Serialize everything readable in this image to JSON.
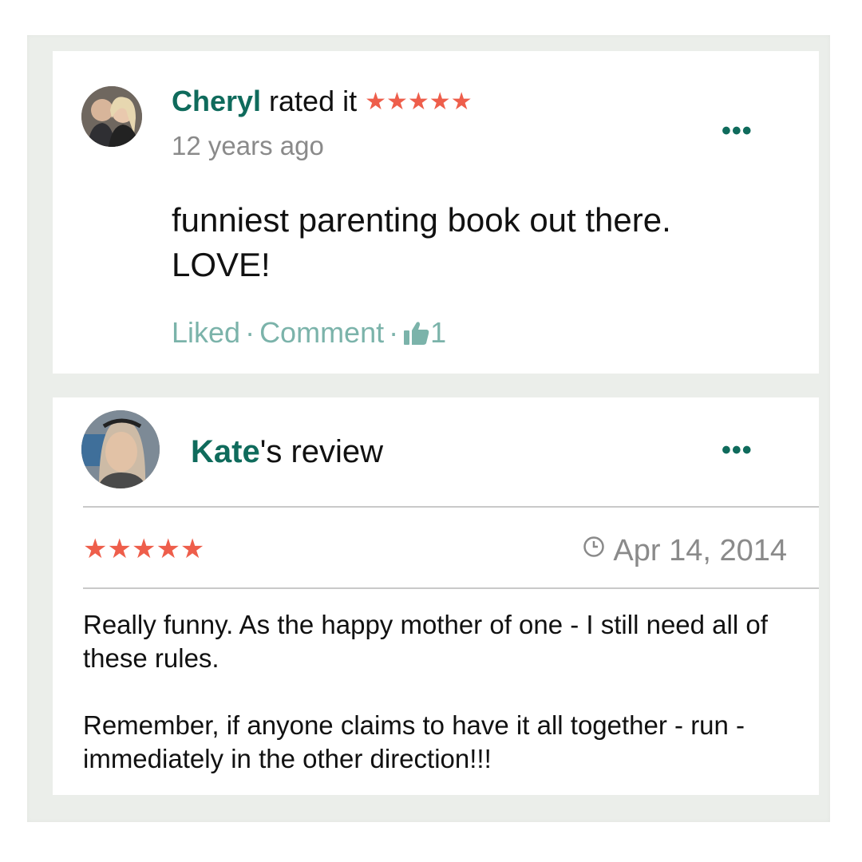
{
  "review1": {
    "name": "Cheryl",
    "action": " rated it ",
    "stars": "★★★★★",
    "time": "12 years ago",
    "text": "funniest parenting book out there. LOVE!",
    "liked_label": "Liked",
    "comment_label": "Comment",
    "separator": "·",
    "likes_count": "1",
    "more_label": "•••",
    "icons": {
      "avatar": "avatar",
      "thumb": "thumbs-up-icon",
      "more": "more-icon"
    }
  },
  "review2": {
    "name": "Kate",
    "title_suffix": "'s review",
    "stars": "★★★★★",
    "date": "Apr 14, 2014",
    "paragraph1": "Really funny. As the happy mother of one - I still need all of these rules.",
    "paragraph2": "Remember, if anyone claims to have it all together - run - immediately in the other direction!!!",
    "more_label": "•••",
    "icons": {
      "avatar": "avatar",
      "clock": "clock-icon",
      "more": "more-icon"
    }
  },
  "colors": {
    "accent": "#0f6b5c",
    "star": "#ee5e4b",
    "muted": "#8a8a8a",
    "action": "#7bb3aa",
    "background": "#ebeeea"
  }
}
